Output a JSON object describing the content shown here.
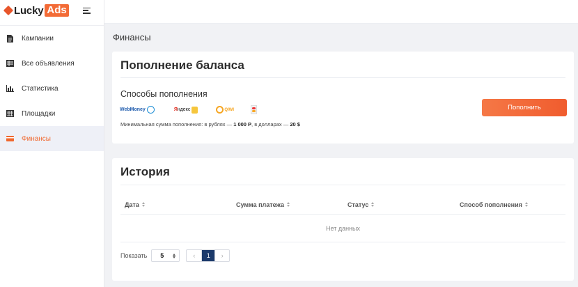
{
  "app": {
    "brand_part1": "Lucky",
    "brand_part2": "Ads",
    "accent_color": "#f05c2e"
  },
  "sidebar": {
    "items": [
      {
        "label": "Кампании",
        "icon": "document-icon",
        "active": false
      },
      {
        "label": "Все объявления",
        "icon": "grid-icon",
        "active": false
      },
      {
        "label": "Статистика",
        "icon": "bar-chart-icon",
        "active": false
      },
      {
        "label": "Площадки",
        "icon": "table-icon",
        "active": true
      },
      {
        "label": "Финансы",
        "icon": "wallet-icon",
        "active": true
      }
    ]
  },
  "page": {
    "title": "Финансы"
  },
  "topup": {
    "title": "Пополнение баланса",
    "methods_title": "Способы пополнения",
    "methods": {
      "webmoney": "WebMoney",
      "yandex_prefix": "Я",
      "yandex_rest": "ндекс",
      "qiwi": "QIWI"
    },
    "min_prefix": "Минимальная сумма пополнения: в рублях —",
    "min_rub": "1 000 Р",
    "min_mid": ", в долларах —",
    "min_usd": "20 $",
    "button_label": "Пополнить"
  },
  "history": {
    "title": "История",
    "columns": [
      "Дата",
      "Сумма платежа",
      "Статус",
      "Способ пополнения"
    ],
    "empty_text": "Нет данных",
    "show_label": "Показать",
    "page_size": "5",
    "prev": "‹",
    "current_page": "1",
    "next": "›"
  }
}
